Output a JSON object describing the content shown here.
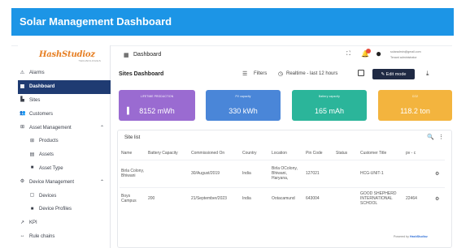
{
  "banner": {
    "title": "Solar Management Dashboard"
  },
  "logo": {
    "main": "HashStudioz",
    "sub": "TECHNOLOGIES"
  },
  "sidebar": {
    "items": [
      {
        "label": "Alarms",
        "icon": "⚠"
      },
      {
        "label": "Dashboard",
        "icon": "▦"
      },
      {
        "label": "Sites",
        "icon": "▙"
      },
      {
        "label": "Customers",
        "icon": "👥"
      },
      {
        "label": "Asset Management",
        "icon": "⊞"
      },
      {
        "label": "Products",
        "icon": "⊞"
      },
      {
        "label": "Assets",
        "icon": "▤"
      },
      {
        "label": "Asset Type",
        "icon": "■"
      },
      {
        "label": "Device Management",
        "icon": "⚙"
      },
      {
        "label": "Devices",
        "icon": "▢"
      },
      {
        "label": "Device Profiles",
        "icon": "■"
      },
      {
        "label": "KPI",
        "icon": "↗"
      },
      {
        "label": "Rule chains",
        "icon": "↔"
      }
    ],
    "chevron": "⌃"
  },
  "topbar": {
    "title": "Dashboard",
    "grid_icon": "▦",
    "expand_icon": "⛶",
    "bell_icon": "🔔",
    "avatar_icon": "●",
    "email": "solaradmin@gmail.com",
    "role": "Tenant administrator"
  },
  "toolbar": {
    "title": "Sites Dashboard",
    "filter_icon": "☰",
    "filters_label": "Filters",
    "clock_icon": "◷",
    "realtime_label": "Realtime - last 12 hours",
    "edit_label": "✎ Edit mode",
    "download_icon": "⤓"
  },
  "cards": [
    {
      "label": "LIFETIME PRODUCTION",
      "value": "8152 mWh",
      "color": "#9a6bd1",
      "icon": "▌"
    },
    {
      "label": "PV capacity",
      "value": "330 kWh",
      "color": "#4a86d8",
      "icon": ""
    },
    {
      "label": "Battery capacity",
      "value": "165 mAh",
      "color": "#2bb59a",
      "icon": ""
    },
    {
      "label": "CO2",
      "value": "118.2 ton",
      "color": "#f3b43e",
      "icon": ""
    }
  ],
  "site_list": {
    "title": "Site list",
    "search_icon": "🔍",
    "menu_icon": "⋮",
    "columns": [
      "Name",
      "Battery Capacity",
      "Commissioned On",
      "Country",
      "Location",
      "Pin Code",
      "Status",
      "Customer Title",
      "pv - c"
    ],
    "rows": [
      {
        "name": "Birla Colony, Bhiwani",
        "battery": "",
        "commissioned": "30/August/2019",
        "country": "India",
        "location": "Birla OColony, Bhiwani, Haryana,",
        "pin": "127021",
        "status": "",
        "customer": "HCG-UNIT-1",
        "pv": "",
        "gear": "⚙"
      },
      {
        "name": "Boys Campus",
        "battery": "200",
        "commissioned": "21/September/2023",
        "country": "India",
        "location": "Ootacamund",
        "pin": "643004",
        "status": "",
        "customer": "GOOD SHEPHERD INTERNATIONAL SCHOOL",
        "pv": "22464",
        "gear": "⚙"
      }
    ]
  },
  "footer": {
    "prefix": "Powered by",
    "brand": "HashStudioz"
  }
}
